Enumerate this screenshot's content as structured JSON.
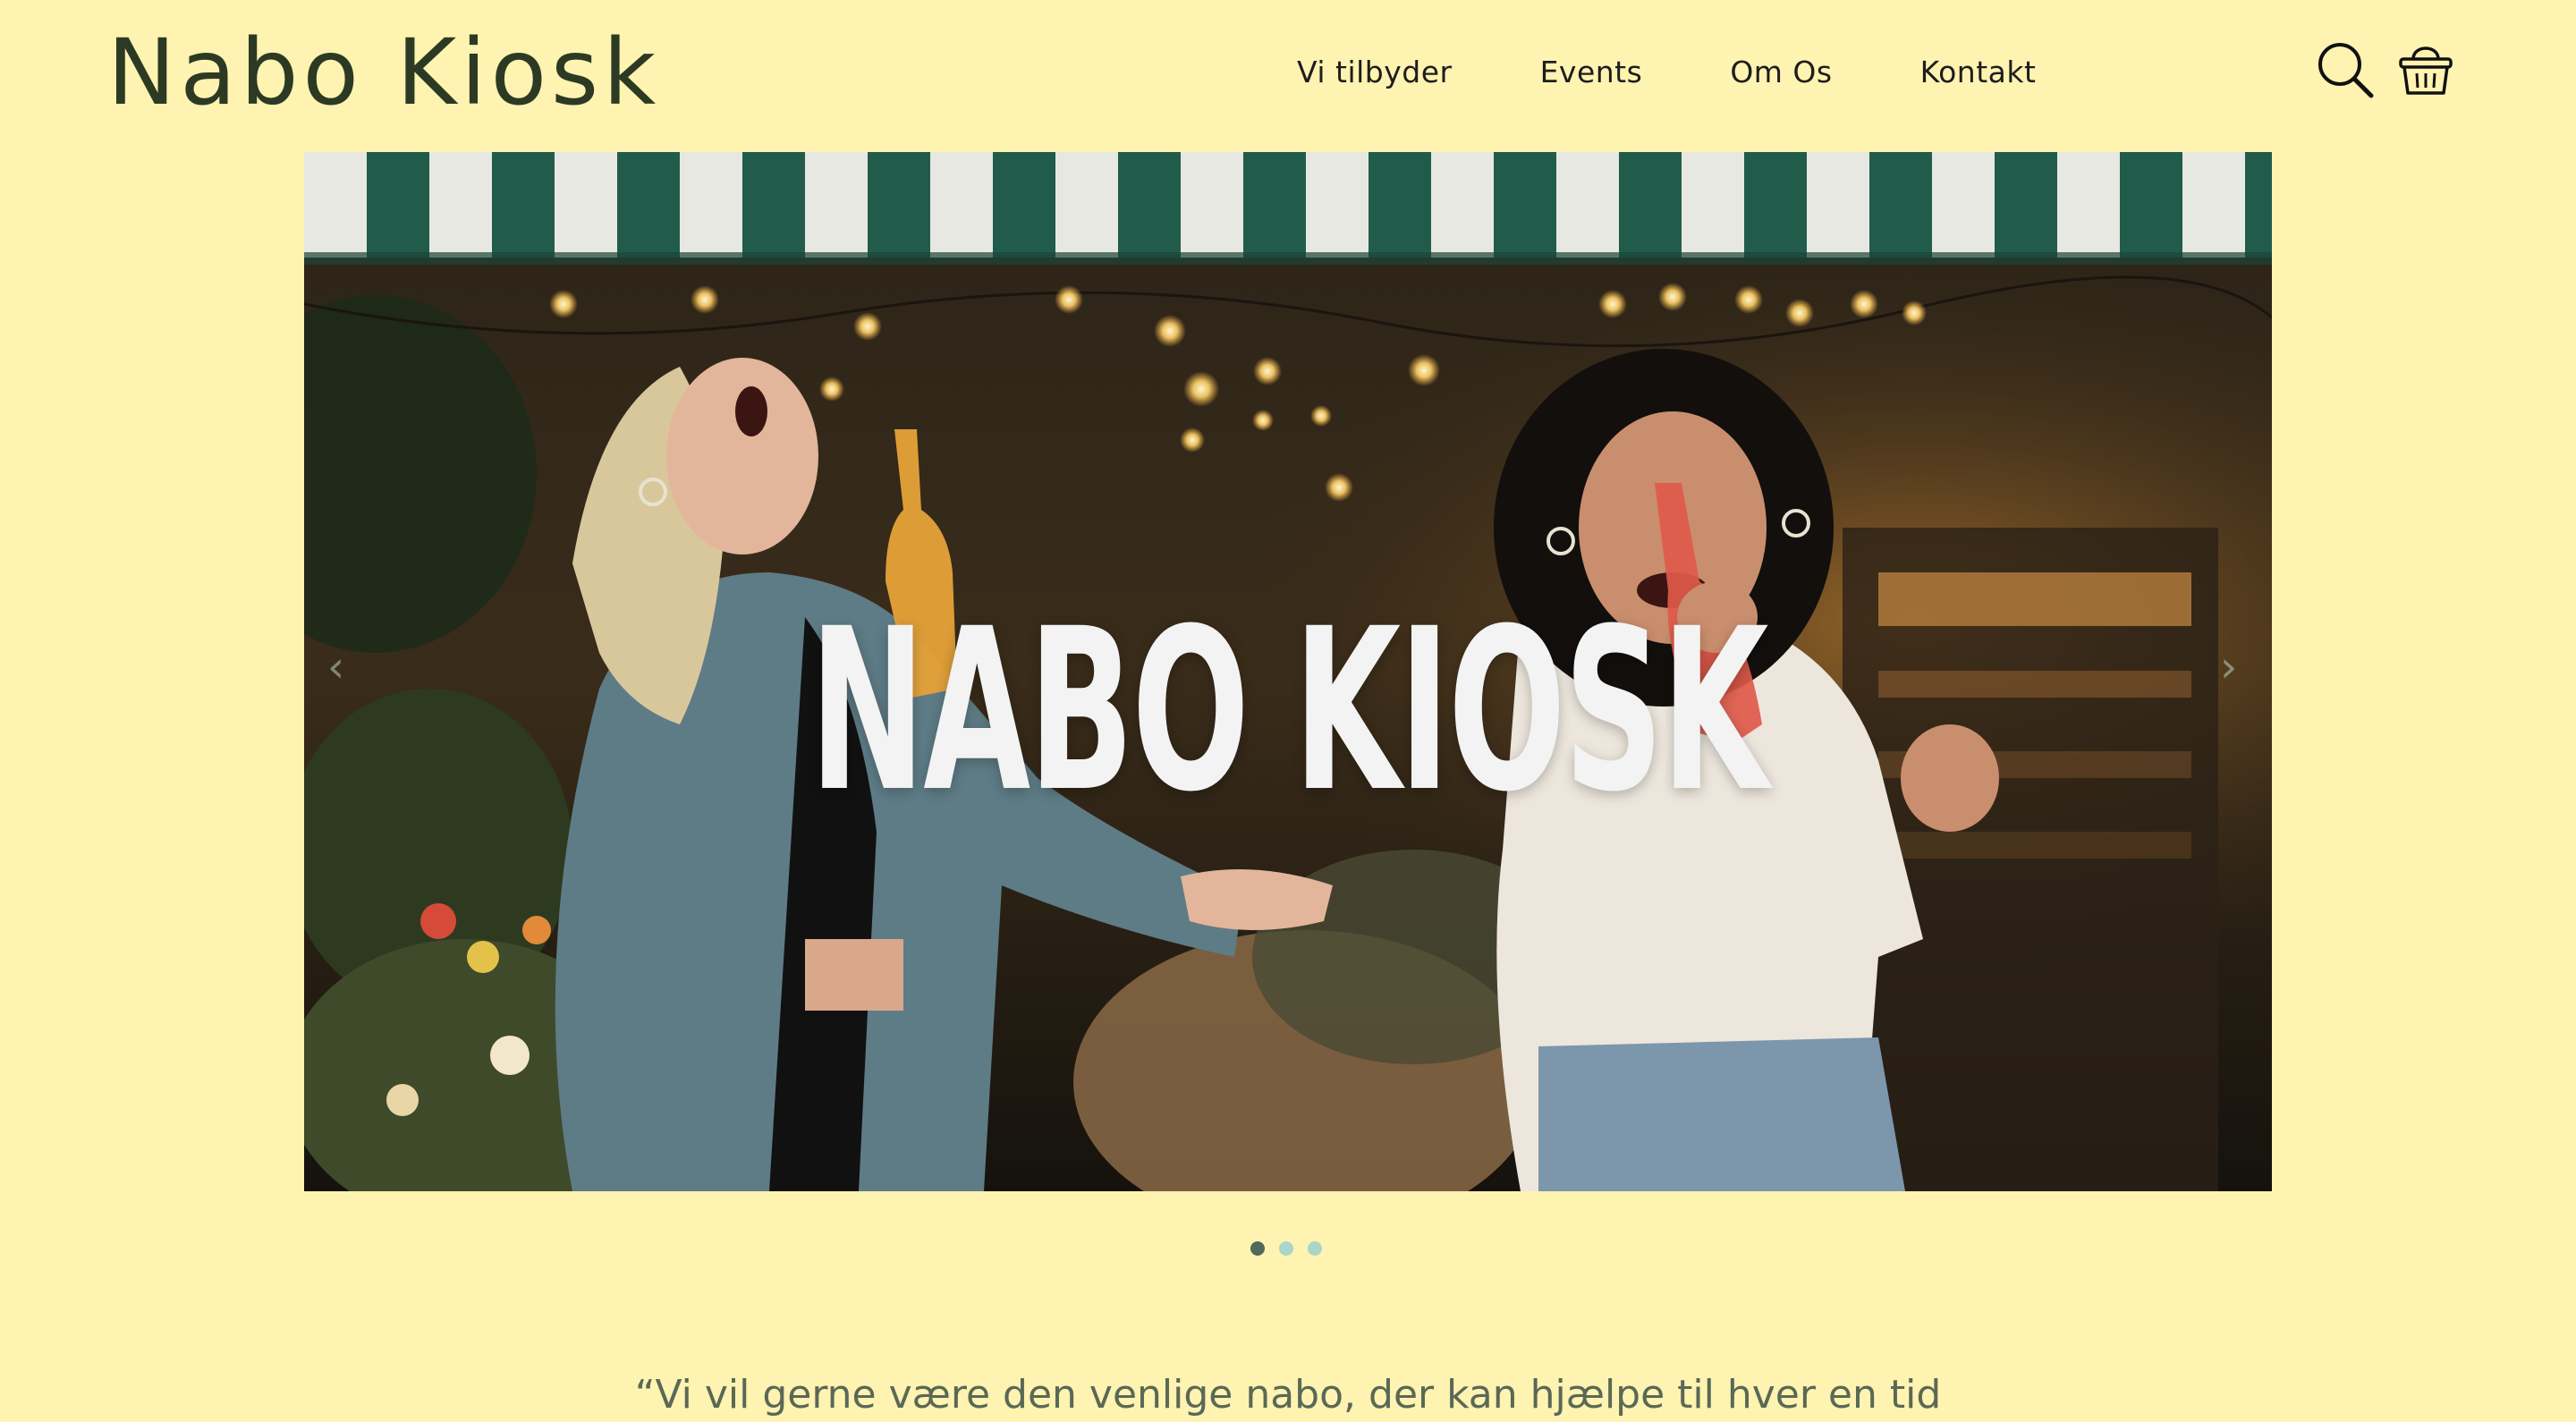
{
  "brand": {
    "logo_text": "Nabo Kiosk"
  },
  "nav": {
    "items": [
      {
        "label": "Vi tilbyder"
      },
      {
        "label": "Events"
      },
      {
        "label": "Om Os"
      },
      {
        "label": "Kontakt"
      }
    ]
  },
  "header_icons": {
    "search": "search-icon",
    "cart": "basket-icon"
  },
  "hero": {
    "title": "NABO KIOSK",
    "prev_arrow": "‹",
    "next_arrow": "›",
    "slide_count": 3,
    "active_slide": 1
  },
  "quote": {
    "text": "“Vi vil gerne være den venlige nabo, der kan hjælpe til hver en tid"
  },
  "colors": {
    "background": "#fef3b0",
    "logo": "#2c3a24",
    "awning_green": "#1f5a4a",
    "dot_active": "#4e6a5c",
    "dot_inactive": "#a9d6c9"
  }
}
